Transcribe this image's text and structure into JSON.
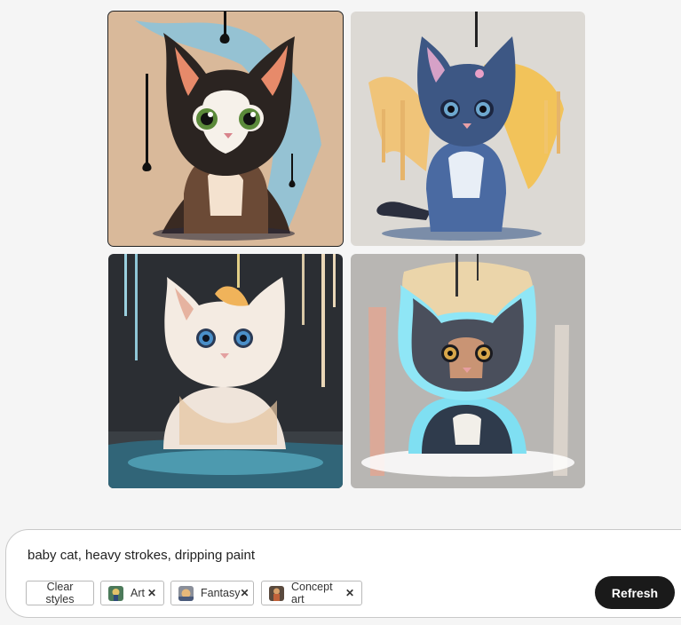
{
  "images": [
    {
      "selected": true
    },
    {
      "selected": false
    },
    {
      "selected": false
    },
    {
      "selected": false
    }
  ],
  "prompt": {
    "text": "baby cat, heavy strokes, dripping paint"
  },
  "styles": {
    "clear_label": "Clear styles",
    "chips": [
      {
        "label": "Art",
        "icon": "art-thumbnail-icon",
        "remove_icon": "close-icon"
      },
      {
        "label": "Fantasy",
        "icon": "fantasy-thumbnail-icon",
        "remove_icon": "close-icon"
      },
      {
        "label": "Concept art",
        "icon": "concept-art-thumbnail-icon",
        "remove_icon": "close-icon"
      }
    ]
  },
  "refresh_label": "Refresh",
  "colors": {
    "refresh_bg": "#1a1a1a",
    "panel_border": "#c9c9c9",
    "page_bg": "#f5f5f5"
  }
}
